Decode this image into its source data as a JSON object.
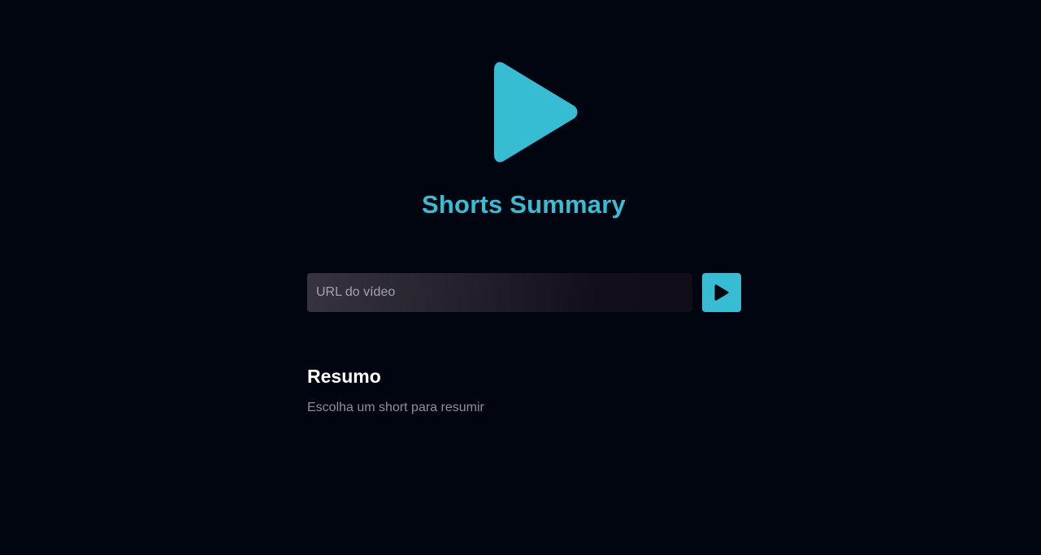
{
  "app": {
    "title": "Shorts Summary",
    "logo_icon": "play-icon",
    "accent_color": "#38bdd3",
    "background_color": "#010510"
  },
  "form": {
    "url_placeholder": "URL do vídeo",
    "url_value": "",
    "submit_icon": "play-icon"
  },
  "summary": {
    "heading": "Resumo",
    "text": "Escolha um short para resumir"
  }
}
